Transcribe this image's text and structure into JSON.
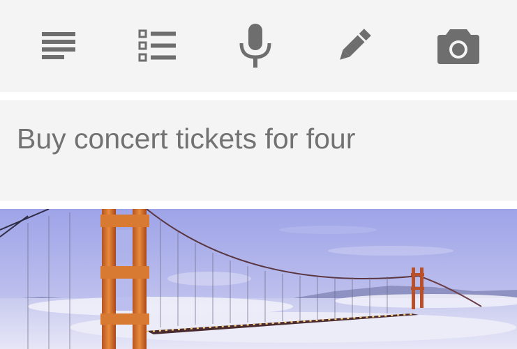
{
  "toolbar": {
    "buttons": [
      {
        "icon": "text-note-icon"
      },
      {
        "icon": "checklist-icon"
      },
      {
        "icon": "microphone-icon"
      },
      {
        "icon": "pen-icon"
      },
      {
        "icon": "camera-icon"
      }
    ],
    "icon_color": "#6e6e6e"
  },
  "note": {
    "text": "Buy concert tickets for four"
  },
  "image": {
    "subject": "golden-gate-bridge-photo"
  },
  "colors": {
    "panel_bg": "#f4f4f4",
    "text": "#727272"
  }
}
